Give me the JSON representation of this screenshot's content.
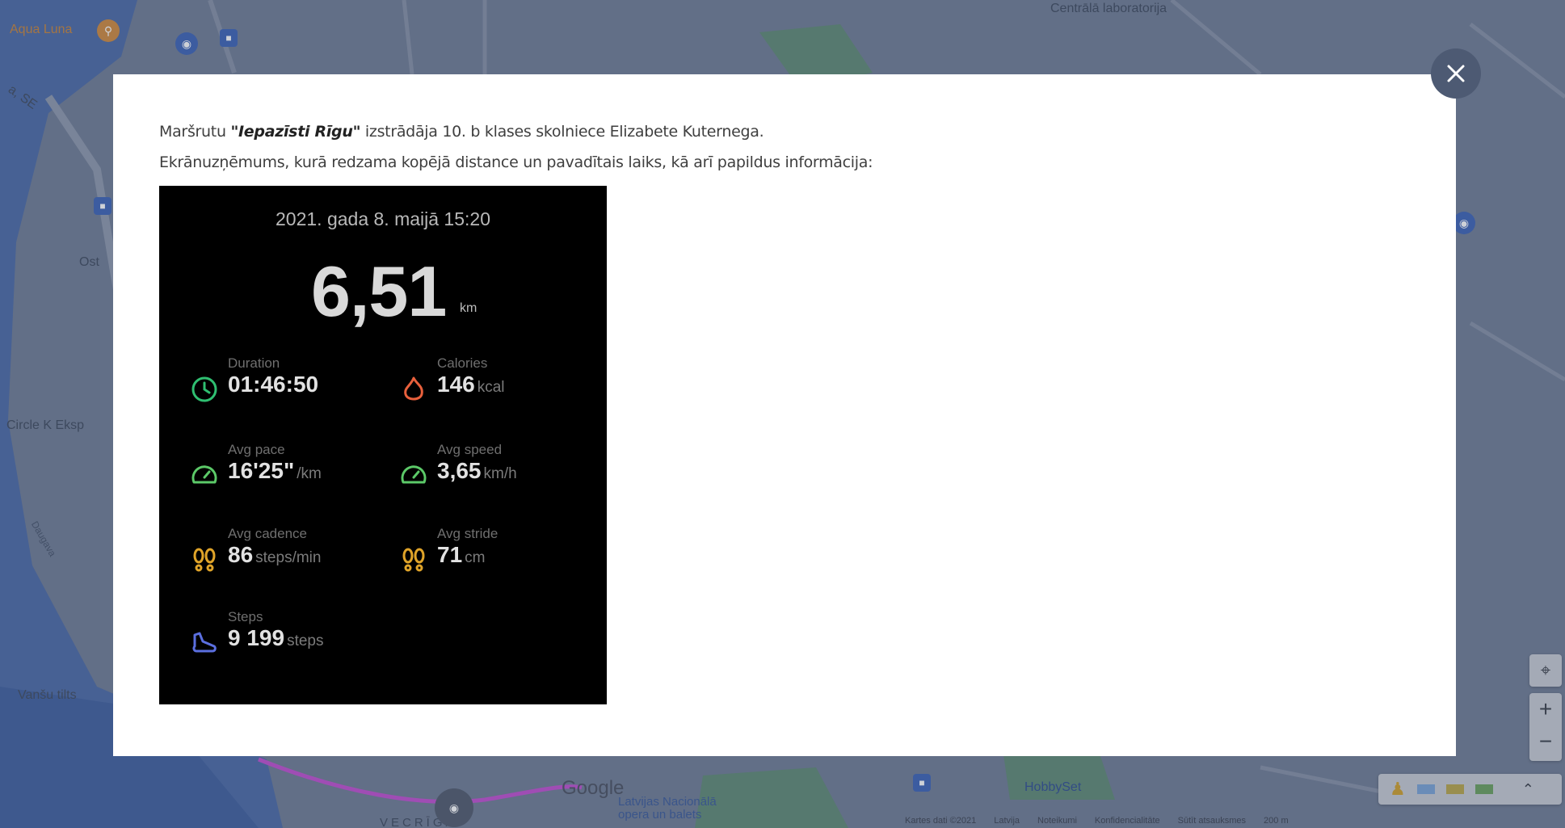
{
  "map": {
    "labels": {
      "aqua_luna": "Aqua Luna",
      "centrala": "Centrālā laboratorija",
      "circle_k": "Circle K Eksp",
      "vansu_tilts": "Vanšu tilts",
      "daugava": "Daugava",
      "ost": "Ost",
      "vecriga": "VECRĪGA",
      "opera": "Latvijas Nacionālā opera un balets",
      "hobbyset": "HobbySet",
      "google": "Google",
      "se": "a, SE"
    },
    "footer": [
      "Kartes dati ©2021",
      "Latvija",
      "Noteikumi",
      "Konfidencialitāte",
      "Sūtīt atsauksmes",
      "200 m"
    ],
    "controls": {
      "zoom_in": "+",
      "zoom_out": "−"
    }
  },
  "modal": {
    "close_label": "×",
    "intro_prefix": "Maršrutu ",
    "route_name": "\"Iepazīsti Rīgu\"",
    "intro_suffix": " izstrādāja 10. b klases skolniece Elizabete Kuternega.",
    "intro_line2": "Ekrānuzņēmums, kurā redzama kopējā distance un pavadītais laiks, kā arī papildus informācija:"
  },
  "fitness": {
    "date": "2021. gada 8. maijā 15:20",
    "distance": "6,51",
    "distance_unit": "km",
    "stats": {
      "duration": {
        "label": "Duration",
        "value": "01:46:50",
        "unit": "",
        "icon": "clock-icon",
        "color": "#2fbf71"
      },
      "calories": {
        "label": "Calories",
        "value": "146",
        "unit": "kcal",
        "icon": "flame-icon",
        "color": "#e8603c"
      },
      "avg_pace": {
        "label": "Avg pace",
        "value": "16'25\"",
        "unit": "/km",
        "icon": "gauge-icon",
        "color": "#5cc968"
      },
      "avg_speed": {
        "label": "Avg speed",
        "value": "3,65",
        "unit": "km/h",
        "icon": "gauge-icon",
        "color": "#5cc968"
      },
      "avg_cadence": {
        "label": "Avg cadence",
        "value": "86",
        "unit": "steps/min",
        "icon": "footprints-icon",
        "color": "#e0a429"
      },
      "avg_stride": {
        "label": "Avg stride",
        "value": "71",
        "unit": "cm",
        "icon": "footprints-icon",
        "color": "#e0a429"
      },
      "steps": {
        "label": "Steps",
        "value": "9 199",
        "unit": "steps",
        "icon": "shoe-icon",
        "color": "#5b6fe0"
      }
    }
  }
}
